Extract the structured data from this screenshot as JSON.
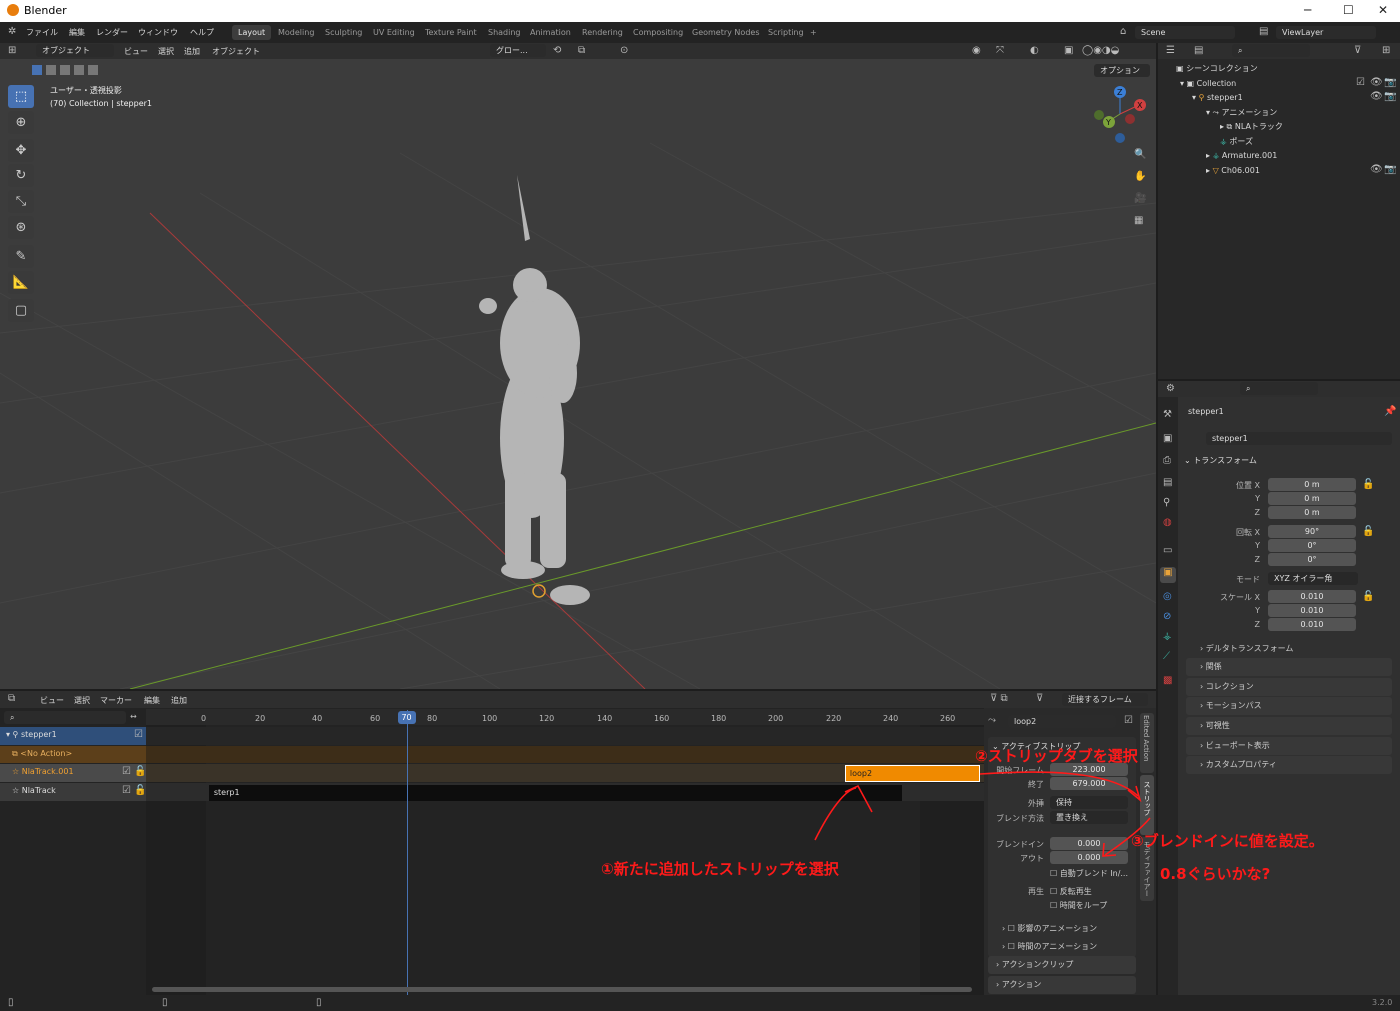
{
  "window": {
    "title": "Blender",
    "min": "─",
    "max": "☐",
    "close": "✕"
  },
  "menu": [
    "ファイル",
    "編集",
    "レンダー",
    "ウィンドウ",
    "ヘルプ"
  ],
  "workspaces": [
    "Layout",
    "Modeling",
    "Sculpting",
    "UV Editing",
    "Texture Paint",
    "Shading",
    "Animation",
    "Rendering",
    "Compositing",
    "Geometry Nodes",
    "Scripting",
    "+"
  ],
  "scene": "Scene",
  "view_layer": "ViewLayer",
  "viewport": {
    "mode": "オブジェクト",
    "menus": [
      "ビュー",
      "選択",
      "追加",
      "オブジェクト"
    ],
    "orientation": "グロー...",
    "options": "オプション",
    "view_name": "ユーザー・透視投影",
    "collection_info": "(70) Collection | stepper1",
    "accent": "#4772b3"
  },
  "outliner": {
    "scene_collection": "シーンコレクション",
    "rows": [
      {
        "label": "Collection",
        "indent": 1
      },
      {
        "label": "stepper1",
        "indent": 2
      },
      {
        "label": "アニメーション",
        "indent": 3
      },
      {
        "label": "NLAトラック",
        "indent": 4
      },
      {
        "label": "ポーズ",
        "indent": 3
      },
      {
        "label": "Armature.001",
        "indent": 2
      },
      {
        "label": "Ch06.001",
        "indent": 2
      }
    ]
  },
  "properties": {
    "object": "stepper1",
    "data": "stepper1",
    "transform_label": "トランスフォーム",
    "location": {
      "label": "位置",
      "x": "0 m",
      "y": "0 m",
      "z": "0 m"
    },
    "rotation": {
      "label": "回転",
      "x": "90°",
      "y": "0°",
      "z": "0°"
    },
    "mode": {
      "label": "モード",
      "value": "XYZ オイラー角"
    },
    "scale": {
      "label": "スケール",
      "x": "0.010",
      "y": "0.010",
      "z": "0.010"
    },
    "axis": {
      "x": "X",
      "y": "Y",
      "z": "Z"
    },
    "delta": "デルタトランスフォーム",
    "sections": [
      "関係",
      "コレクション",
      "モーションパス",
      "可視性",
      "ビューポート表示",
      "カスタムプロパティ"
    ]
  },
  "nla": {
    "menus": [
      "ビュー",
      "選択",
      "マーカー",
      "編集",
      "追加"
    ],
    "snap": "近接するフレーム",
    "current_frame": "70",
    "ticks": [
      "0",
      "20",
      "40",
      "60",
      "80",
      "100",
      "120",
      "140",
      "160",
      "180",
      "200",
      "220",
      "240",
      "260"
    ],
    "tracks": [
      {
        "name": "stepper1"
      },
      {
        "name": "<No Action>"
      },
      {
        "name": "NlaTrack.001"
      },
      {
        "name": "NlaTrack"
      }
    ],
    "strips": [
      {
        "name": "loop2",
        "start": 223,
        "end": 679,
        "color": "#f08a00"
      },
      {
        "name": "sterp1",
        "start": 1,
        "end": 243,
        "color": "#0d0d0d"
      }
    ]
  },
  "sidebar": {
    "strip_name": "loop2",
    "active_strip": "アクティブストリップ",
    "start": {
      "label": "開始フレーム",
      "value": "223.000"
    },
    "end": {
      "label": "終了",
      "value": "679.000"
    },
    "extrap": {
      "label": "外挿",
      "value": "保持"
    },
    "blend": {
      "label": "ブレンド方法",
      "value": "置き換え"
    },
    "blend_in": {
      "label": "ブレンドイン",
      "value": "0.000"
    },
    "blend_out": {
      "label": "アウト",
      "value": "0.000"
    },
    "auto_blend": "自動ブレンド In/...",
    "playback_label": "再生",
    "reverse": "反転再生",
    "cyclic": "時間をループ",
    "influence": "影響のアニメーション",
    "strip_time": "時間のアニメーション",
    "action_clip": "アクションクリップ",
    "action": "アクション",
    "tabs": [
      "Edited Action",
      "ストリップ",
      "モディファイアー"
    ]
  },
  "annotations": {
    "a1": "①新たに追加したストリップを選択",
    "a2": "②ストリップタブを選択",
    "a3": "③ブレンドインに値を設定。",
    "a4": "0.8ぐらいかな?"
  },
  "version": "3.2.0"
}
